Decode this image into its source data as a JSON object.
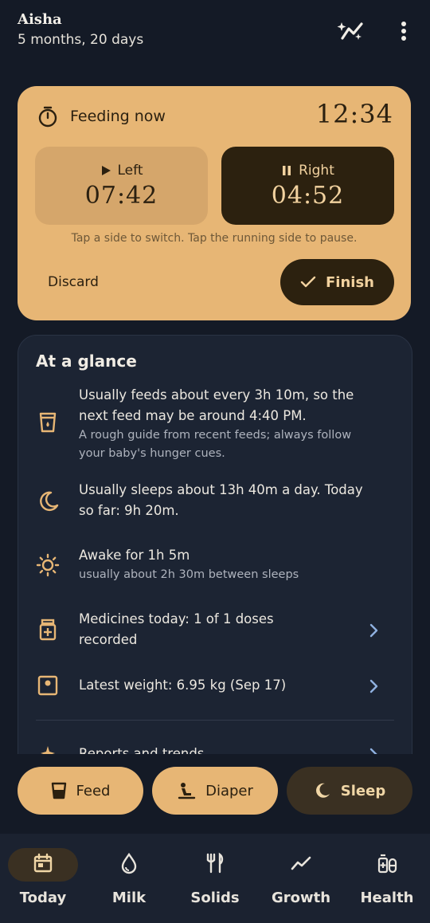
{
  "header": {
    "baby_name": "Aisha",
    "age": "5 months, 20 days"
  },
  "feeding": {
    "title": "Feeding now",
    "total_time": "12:34",
    "left": {
      "label": "Left",
      "time": "07:42",
      "state": "play"
    },
    "right": {
      "label": "Right",
      "time": "04:52",
      "state": "pause"
    },
    "hint": "Tap a side to switch. Tap the running side to pause.",
    "discard_label": "Discard",
    "finish_label": "Finish"
  },
  "glance": {
    "title": "At a glance",
    "feed_main": "Usually feeds about every 3h 10m, so the next feed may be around 4:40 PM.",
    "feed_sub": "A rough guide from recent feeds; always follow your baby's hunger cues.",
    "sleep_main": "Usually sleeps about 13h 40m a day. Today so far: 9h 20m.",
    "awake_main": "Awake for 1h 5m",
    "awake_sub": "usually about 2h 30m between sleeps",
    "medicine_main": "Medicines today: 1 of 1 doses recorded",
    "weight_main": "Latest weight: 6.95 kg (Sep 17)",
    "reports_main": "Reports and trends"
  },
  "quick_actions": {
    "feed": "Feed",
    "diaper": "Diaper",
    "sleep": "Sleep"
  },
  "nav": {
    "today": "Today",
    "milk": "Milk",
    "solids": "Solids",
    "growth": "Growth",
    "health": "Health"
  },
  "colors": {
    "background": "#141a26",
    "accent": "#e7b675",
    "dark_brown": "#2c210f",
    "card": "#1c2433",
    "chevron": "#8fb1e0"
  }
}
